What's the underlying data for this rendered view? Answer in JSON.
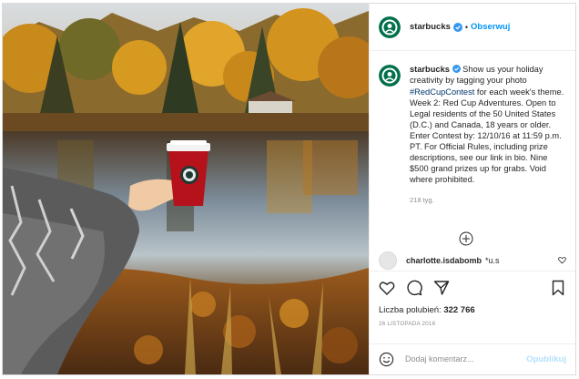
{
  "post": {
    "username": "starbucks",
    "follow_label": "Obserwuj",
    "caption_user": "starbucks",
    "caption_before": "Show us your holiday creativity by tagging your photo",
    "hashtag": "#RedCupContest",
    "caption_after": "for each week's theme. Week 2: Red Cup Adventures. Open to Legal residents of the 50 United States (D.C.) and Canada, 18 years or older. Enter Contest by: 12/10/16 at 11:59 p.m. PT. For Official Rules, including prize descriptions, see our link in bio. Nine $500 grand prizes up for grabs. Void where prohibited.",
    "caption_age": "218 tyg.",
    "likes_label": "Liczba polubień:",
    "likes_count": "322 766",
    "date": "26 LISTOPADA 2016"
  },
  "comment": {
    "username": "charlotte.isdabomb",
    "text": "*u.s"
  },
  "comment_box": {
    "placeholder": "Dodaj komentarz...",
    "post_label": "Opublikuj"
  },
  "colors": {
    "brand_green": "#00704a",
    "link_blue": "#0095f6",
    "hashtag_blue": "#00376b",
    "verified_blue": "#3897f0",
    "post_disabled": "#b2dffc"
  },
  "icons": [
    "starbucks-logo-icon",
    "verified-badge-icon",
    "load-more-icon",
    "heart-icon",
    "comment-icon",
    "share-icon",
    "bookmark-icon",
    "emoji-icon"
  ]
}
